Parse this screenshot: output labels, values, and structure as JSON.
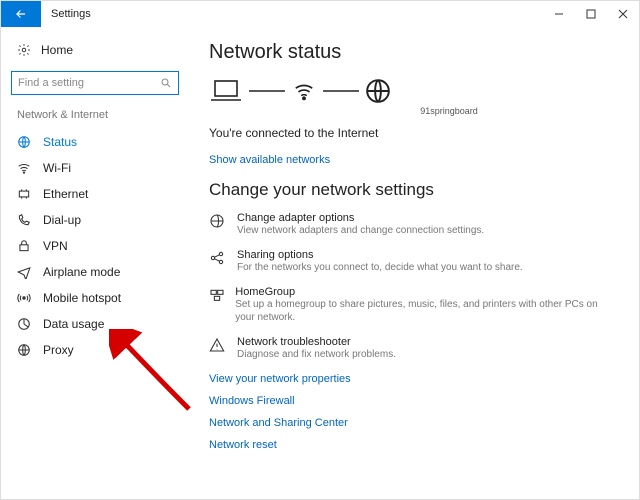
{
  "window": {
    "title": "Settings"
  },
  "sidebar": {
    "home": "Home",
    "search_placeholder": "Find a setting",
    "section": "Network & Internet",
    "items": [
      {
        "label": "Status",
        "active": true
      },
      {
        "label": "Wi-Fi"
      },
      {
        "label": "Ethernet"
      },
      {
        "label": "Dial-up"
      },
      {
        "label": "VPN"
      },
      {
        "label": "Airplane mode"
      },
      {
        "label": "Mobile hotspot"
      },
      {
        "label": "Data usage"
      },
      {
        "label": "Proxy"
      }
    ]
  },
  "main": {
    "heading": "Network status",
    "ssid": "91springboard",
    "connected": "You're connected to the Internet",
    "show_available": "Show available networks",
    "change_heading": "Change your network settings",
    "options": [
      {
        "title": "Change adapter options",
        "desc": "View network adapters and change connection settings."
      },
      {
        "title": "Sharing options",
        "desc": "For the networks you connect to, decide what you want to share."
      },
      {
        "title": "HomeGroup",
        "desc": "Set up a homegroup to share pictures, music, files, and printers with other PCs on your network."
      },
      {
        "title": "Network troubleshooter",
        "desc": "Diagnose and fix network problems."
      }
    ],
    "links": [
      "View your network properties",
      "Windows Firewall",
      "Network and Sharing Center",
      "Network reset"
    ]
  }
}
